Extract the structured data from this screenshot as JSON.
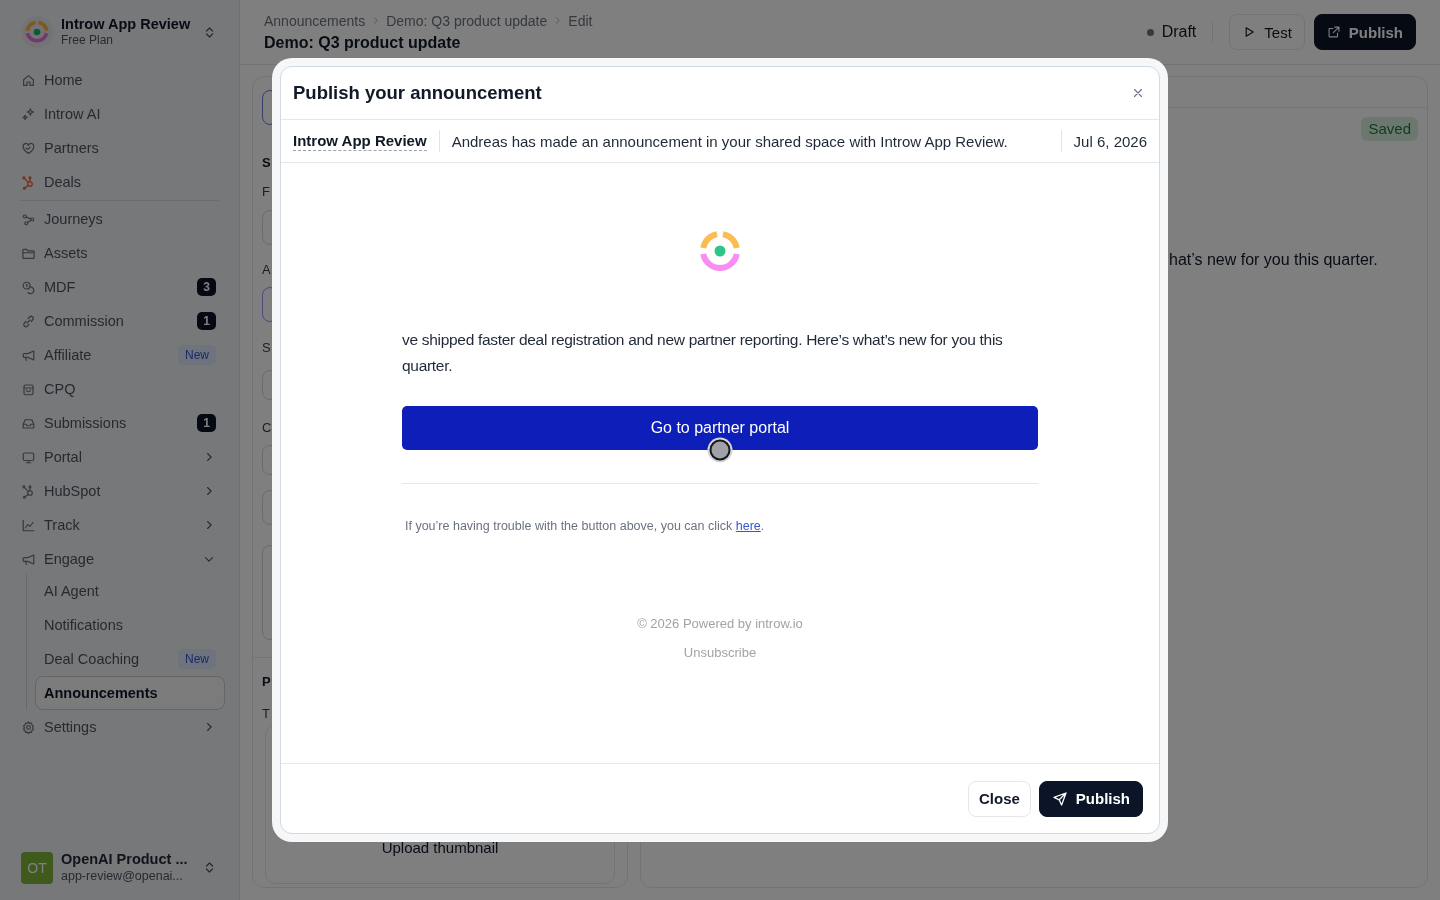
{
  "sidebar": {
    "workspace": {
      "name": "Introw App Review",
      "plan": "Free Plan"
    },
    "sections": [
      {
        "items": [
          {
            "label": "Home",
            "selected": false
          },
          {
            "label": "Introw AI",
            "selected": false
          },
          {
            "label": "Partners",
            "selected": false
          },
          {
            "label": "Deals",
            "selected": false
          }
        ]
      },
      {
        "items": [
          {
            "label": "Journeys",
            "selected": false
          },
          {
            "label": "Assets",
            "selected": false
          },
          {
            "label": "MDF",
            "selected": false,
            "badge": {
              "kind": "count",
              "text": "3"
            }
          },
          {
            "label": "Commission",
            "selected": false,
            "badge": {
              "kind": "count",
              "text": "1"
            }
          },
          {
            "label": "Affiliate",
            "selected": false,
            "badge": {
              "kind": "new",
              "text": "New"
            }
          },
          {
            "label": "CPQ",
            "selected": false
          },
          {
            "label": "Submissions",
            "selected": false,
            "badge": {
              "kind": "count",
              "text": "1"
            }
          },
          {
            "label": "Portal",
            "selected": false,
            "expanded": false
          },
          {
            "label": "HubSpot",
            "selected": false,
            "expanded": false
          },
          {
            "label": "Track",
            "selected": false,
            "expanded": false
          },
          {
            "label": "Engage",
            "selected": false,
            "expanded": true,
            "children": [
              {
                "label": "AI Agent",
                "selected": false
              },
              {
                "label": "Notifications",
                "selected": false
              },
              {
                "label": "Deal Coaching",
                "selected": false,
                "badge": {
                  "kind": "new",
                  "text": "New"
                }
              },
              {
                "label": "Announcements",
                "selected": true
              }
            ]
          },
          {
            "label": "Settings",
            "selected": false,
            "expanded": false
          }
        ]
      }
    ],
    "account": {
      "initials": "OT",
      "name": "OpenAI Product ...",
      "email": "app-review@openai..."
    }
  },
  "header": {
    "breadcrumb": [
      "Announcements",
      "Demo: Q3 product update",
      "Edit"
    ],
    "title": "Demo: Q3 product update",
    "status": "Draft",
    "actions": [
      {
        "label": "Test",
        "kind": "secondary"
      },
      {
        "label": "Publish",
        "kind": "primary"
      }
    ]
  },
  "editor": {
    "form_panel": {
      "labels": [
        "S",
        "F",
        "A",
        "S",
        "C",
        "P",
        "T"
      ],
      "upload_label": "Upload thumbnail"
    },
    "preview_panel": {
      "badge": "Saved",
      "text": "hat’s new for you this quarter."
    }
  },
  "dialog": {
    "title": "Publish your announcement",
    "meta": {
      "sender": "Introw App Review",
      "message": "Andreas has made an announcement in your shared space with Introw App Review.",
      "date": "Jul 6, 2026"
    },
    "email": {
      "body": "ve shipped faster deal registration and new partner reporting. Here’s what’s new for you this quarter.",
      "cta": "Go to partner portal",
      "help": {
        "before": "If you’re having trouble with the button above, you can click ",
        "link": "here",
        "after": "."
      },
      "copyright": "© 2026 Powered by introw.io",
      "unsubscribe": "Unsubscribe"
    },
    "buttons": [
      {
        "label": "Close",
        "kind": "secondary"
      },
      {
        "label": "Publish",
        "kind": "primary"
      }
    ]
  }
}
